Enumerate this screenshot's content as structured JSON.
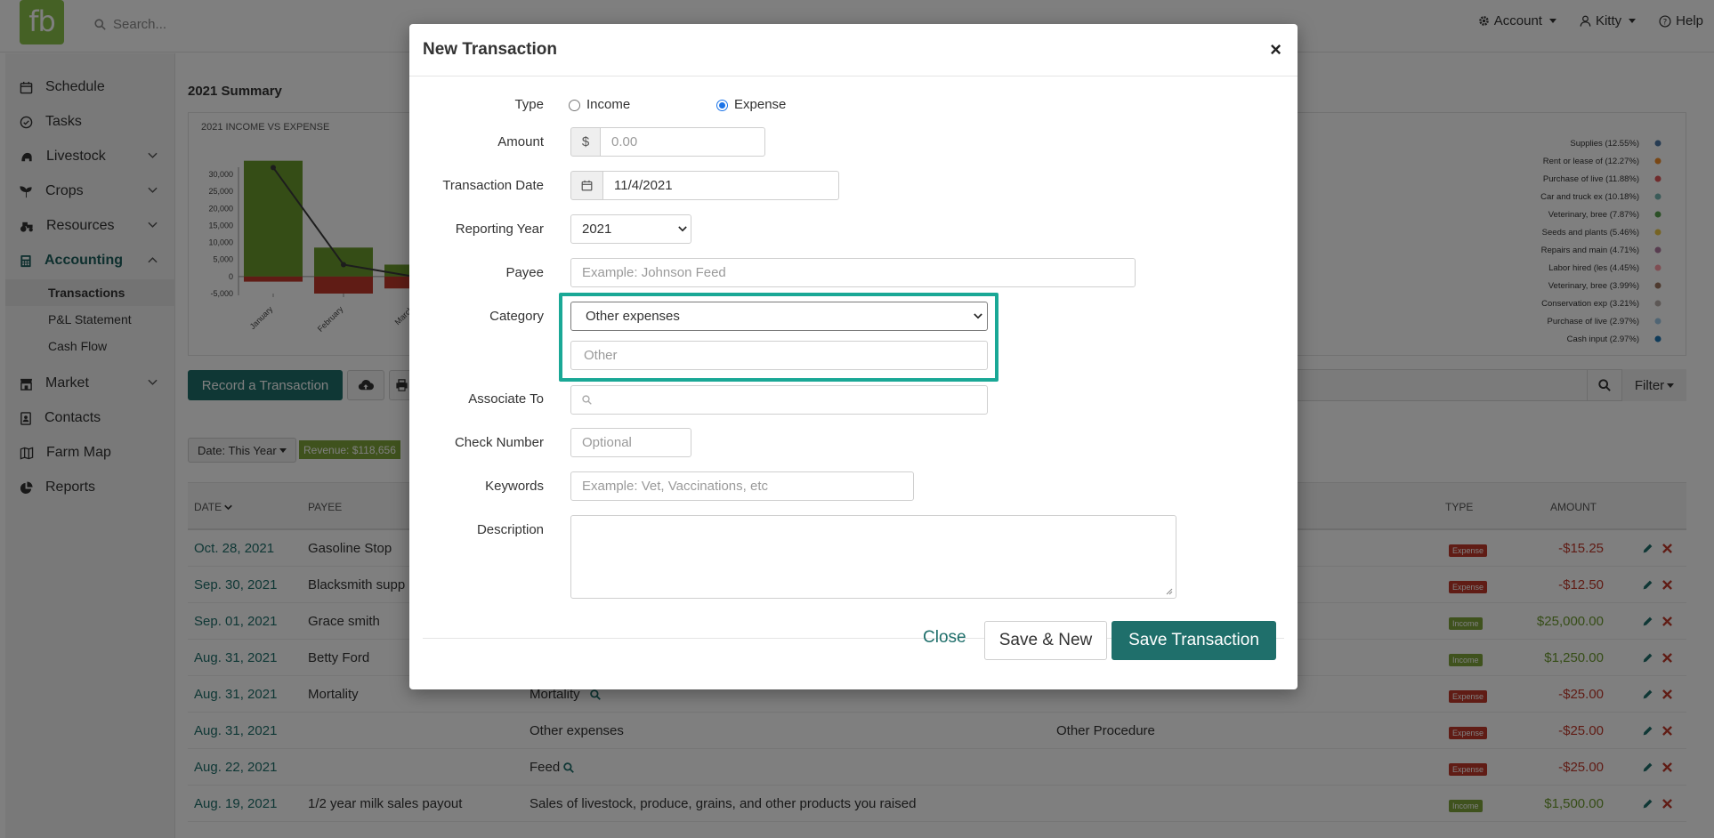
{
  "header": {
    "logo_text": "fb",
    "search_placeholder": "Search...",
    "account_label": "Account",
    "user_label": "Kitty",
    "help_label": "Help"
  },
  "sidebar": {
    "items": [
      {
        "label": "Schedule"
      },
      {
        "label": "Tasks"
      },
      {
        "label": "Livestock"
      },
      {
        "label": "Crops"
      },
      {
        "label": "Resources"
      },
      {
        "label": "Accounting"
      },
      {
        "label": "Market"
      },
      {
        "label": "Contacts"
      },
      {
        "label": "Farm Map"
      },
      {
        "label": "Reports"
      }
    ],
    "accounting_sub": [
      "Transactions",
      "P&L Statement",
      "Cash Flow"
    ]
  },
  "main": {
    "summary_title": "2021 Summary",
    "chart_title": "2021 INCOME VS EXPENSE",
    "record_button": "Record a Transaction",
    "filter_label": "Filter",
    "date_chip": "Date: This Year",
    "revenue_chip": "Revenue: $118,656"
  },
  "chart_data": {
    "type": "bar",
    "title": "2021 INCOME VS EXPENSE",
    "categories": [
      "January",
      "February",
      "March"
    ],
    "series": [
      {
        "values": [
          34000,
          8500,
          3500
        ]
      },
      {
        "values": [
          -1500,
          -5000,
          -3500
        ]
      }
    ],
    "line": [
      32000,
      3500,
      0
    ],
    "ylim": [
      -5000,
      30000
    ],
    "yticks": [
      "30,000",
      "25,000",
      "20,000",
      "15,000",
      "10,000",
      "5,000",
      "0",
      "-5,000"
    ],
    "legend": [
      {
        "label": "Supplies (12.55%)",
        "color": "#4e79a7"
      },
      {
        "label": "Rent or lease of (12.27%)",
        "color": "#f28e2b"
      },
      {
        "label": "Purchase of live (11.88%)",
        "color": "#e15759"
      },
      {
        "label": "Car and truck ex (10.18%)",
        "color": "#76b7b2"
      },
      {
        "label": "Veterinary, bree (7.87%)",
        "color": "#59a14f"
      },
      {
        "label": "Seeds and plants (5.46%)",
        "color": "#edc948"
      },
      {
        "label": "Repairs and main (4.71%)",
        "color": "#b07aa1"
      },
      {
        "label": "Labor hired (les (4.45%)",
        "color": "#ff9da7"
      },
      {
        "label": "Veterinary, bree (3.99%)",
        "color": "#9c755f"
      },
      {
        "label": "Conservation exp (3.21%)",
        "color": "#bab0ac"
      },
      {
        "label": "Purchase of live (2.97%)",
        "color": "#a0cbe8"
      },
      {
        "label": "Cash input (2.97%)",
        "color": "#1f77b4"
      }
    ]
  },
  "table": {
    "headers": {
      "date": "DATE",
      "payee": "PAYEE",
      "type": "TYPE",
      "amount": "AMOUNT"
    },
    "rows": [
      {
        "date": "Oct. 28, 2021",
        "payee": "Gasoline Stop",
        "category": "",
        "note": "",
        "type": "Expense",
        "amount": "-$15.25"
      },
      {
        "date": "Sep. 30, 2021",
        "payee": "Blacksmith supp",
        "category": "",
        "note": "",
        "type": "Expense",
        "amount": "-$12.50"
      },
      {
        "date": "Sep. 01, 2021",
        "payee": "Grace smith",
        "category": "",
        "note": "",
        "type": "Income",
        "amount": "$25,000.00"
      },
      {
        "date": "Aug. 31, 2021",
        "payee": "Betty Ford",
        "category": "",
        "note": "",
        "type": "Income",
        "amount": "$1,250.00"
      },
      {
        "date": "Aug. 31, 2021",
        "payee": "Mortality",
        "category": "Mortality",
        "note": "",
        "type": "Expense",
        "amount": "-$25.00"
      },
      {
        "date": "Aug. 31, 2021",
        "payee": "",
        "category": "Other expenses",
        "note": "Other Procedure",
        "type": "Expense",
        "amount": "-$25.00"
      },
      {
        "date": "Aug. 22, 2021",
        "payee": "",
        "category": "Feed",
        "note": "",
        "type": "Expense",
        "amount": "-$25.00"
      },
      {
        "date": "Aug. 19, 2021",
        "payee": "1/2 year milk sales payout",
        "category": "Sales of livestock, produce, grains, and other products you raised",
        "note": "",
        "type": "Income",
        "amount": "$1,500.00"
      }
    ]
  },
  "modal": {
    "title": "New Transaction",
    "close_x": "×",
    "type_label": "Type",
    "income_label": "Income",
    "expense_label": "Expense",
    "amount_label": "Amount",
    "currency": "$",
    "amount_placeholder": "0.00",
    "date_label": "Transaction Date",
    "date_value": "11/4/2021",
    "year_label": "Reporting Year",
    "year_value": "2021",
    "payee_label": "Payee",
    "payee_placeholder": "Example: Johnson Feed",
    "category_label": "Category",
    "category_value": "Other expenses",
    "other_placeholder": "Other",
    "associate_label": "Associate To",
    "check_label": "Check Number",
    "check_placeholder": "Optional",
    "keywords_label": "Keywords",
    "keywords_placeholder": "Example: Vet, Vaccinations, etc",
    "description_label": "Description",
    "close_button": "Close",
    "save_new_button": "Save & New",
    "save_button": "Save Transaction"
  }
}
